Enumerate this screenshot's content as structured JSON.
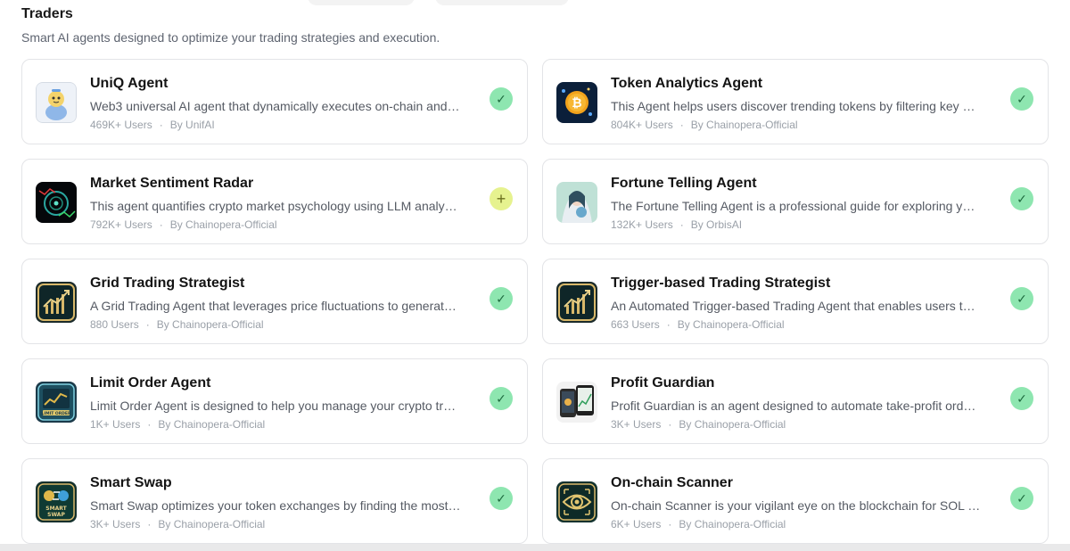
{
  "section": {
    "title": "Traders",
    "subtitle": "Smart AI agents designed to optimize your trading strategies and execution."
  },
  "colors": {
    "added_badge": "#8ee6b0",
    "add_badge": "#e6f28f",
    "card_border": "#e3e4e7"
  },
  "agents": [
    {
      "name": "UniQ Agent",
      "description": "Web3 universal AI agent that dynamically executes on-chain and cross-chain operations",
      "users": "469K+ Users",
      "author": "By UnifAI",
      "status": "added",
      "status_icon": "✓",
      "icon": "uniq-avatar-icon"
    },
    {
      "name": "Token Analytics Agent",
      "description": "This Agent helps users discover trending tokens by filtering key metrics",
      "users": "804K+ Users",
      "author": "By Chainopera-Official",
      "status": "added",
      "status_icon": "✓",
      "icon": "bitcoin-icon"
    },
    {
      "name": "Market Sentiment Radar",
      "description": "This agent quantifies crypto market psychology using LLM analysis of data",
      "users": "792K+ Users",
      "author": "By Chainopera-Official",
      "status": "add",
      "status_icon": "+",
      "icon": "radar-icon"
    },
    {
      "name": "Fortune Telling Agent",
      "description": "The Fortune Telling Agent is a professional guide for exploring your future",
      "users": "132K+ Users",
      "author": "By OrbisAI",
      "status": "added",
      "status_icon": "✓",
      "icon": "fortune-teller-icon"
    },
    {
      "name": "Grid Trading Strategist",
      "description": "A Grid Trading Agent that leverages price fluctuations to generate profits",
      "users": "880 Users",
      "author": "By Chainopera-Official",
      "status": "added",
      "status_icon": "✓",
      "icon": "trading-chart-icon"
    },
    {
      "name": "Trigger-based Trading Strategist",
      "description": "An Automated Trigger-based Trading Agent that enables users to set conditions",
      "users": "663 Users",
      "author": "By Chainopera-Official",
      "status": "added",
      "status_icon": "✓",
      "icon": "trading-chart-icon"
    },
    {
      "name": "Limit Order Agent",
      "description": "Limit Order Agent is designed to help you manage your crypto trades",
      "users": "1K+ Users",
      "author": "By Chainopera-Official",
      "status": "added",
      "status_icon": "✓",
      "icon": "limit-order-icon"
    },
    {
      "name": "Profit Guardian",
      "description": "Profit Guardian is an agent designed to automate take-profit orders for you",
      "users": "3K+ Users",
      "author": "By Chainopera-Official",
      "status": "added",
      "status_icon": "✓",
      "icon": "phone-chart-icon"
    },
    {
      "name": "Smart Swap",
      "description": "Smart Swap optimizes your token exchanges by finding the most efficient routes",
      "users": "3K+ Users",
      "author": "By Chainopera-Official",
      "status": "added",
      "status_icon": "✓",
      "icon": "smart-swap-icon"
    },
    {
      "name": "On-chain Scanner",
      "description": "On-chain Scanner is your vigilant eye on the blockchain for SOL tokens",
      "users": "6K+ Users",
      "author": "By Chainopera-Official",
      "status": "added",
      "status_icon": "✓",
      "icon": "scanner-eye-icon"
    }
  ]
}
